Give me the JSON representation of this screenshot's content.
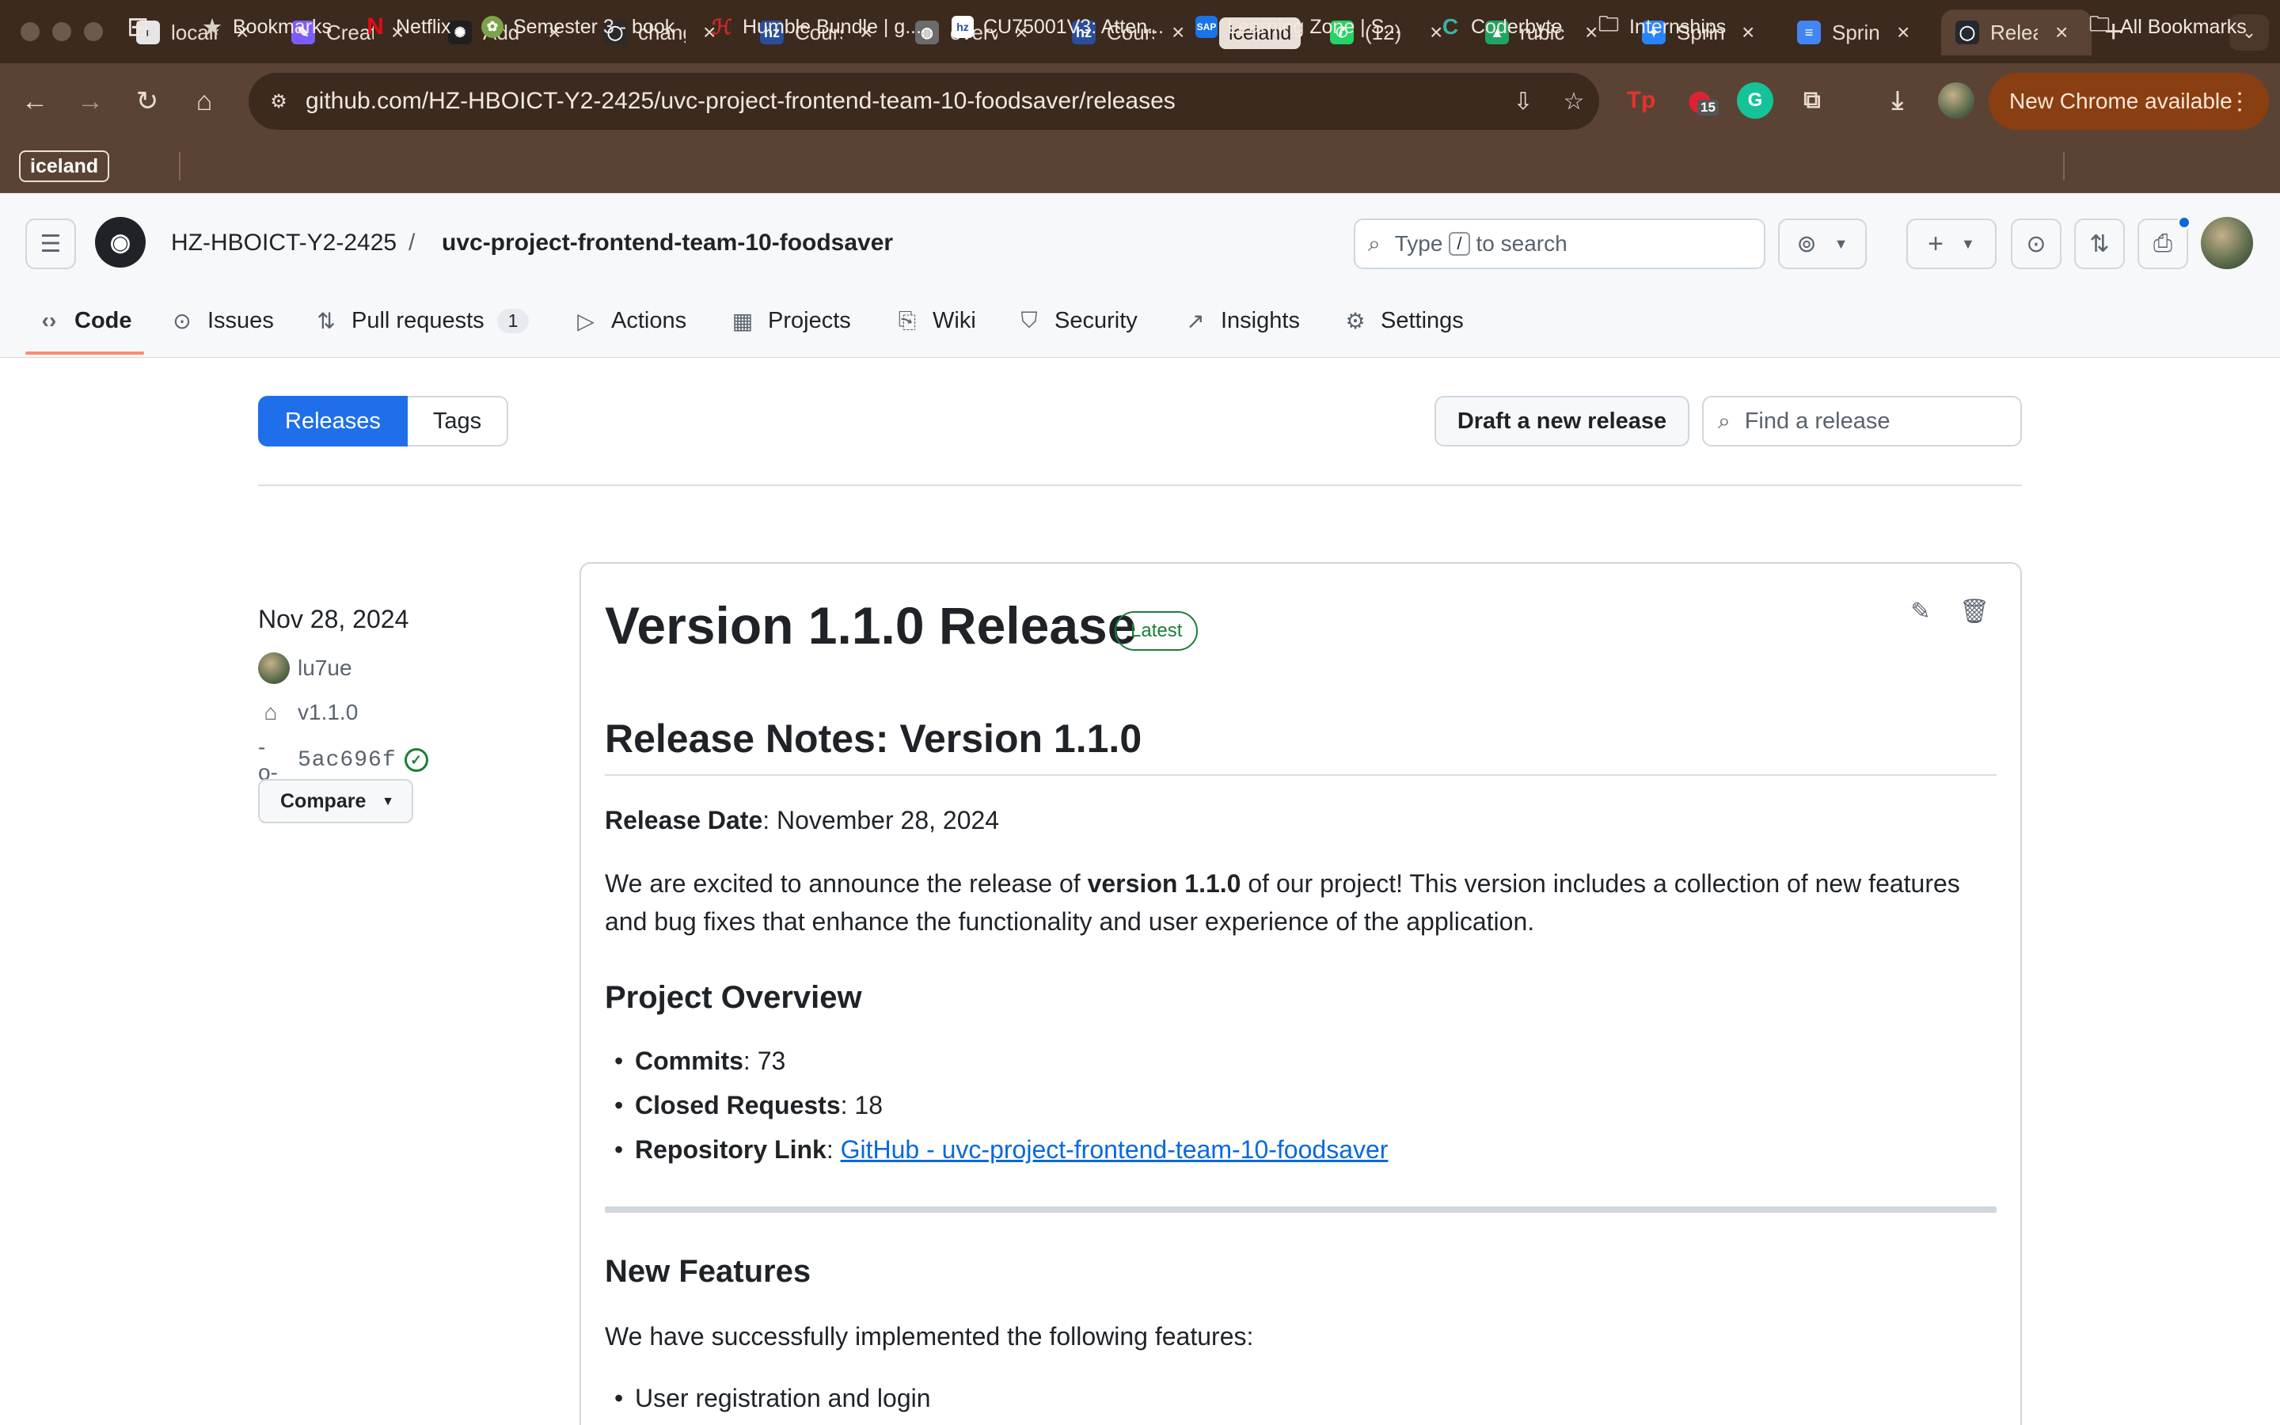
{
  "browser": {
    "tabs": [
      {
        "title": "localhost",
        "favicon_color": "#e6e6e6",
        "favicon_char": "◐"
      },
      {
        "title": "Create",
        "favicon_color": "#7b5cff",
        "favicon_char": "✎"
      },
      {
        "title": "Add",
        "favicon_color": "#1f1f1f",
        "favicon_char": "✺"
      },
      {
        "title": "changes",
        "favicon_color": "#2b2b2b",
        "favicon_char": "◯"
      },
      {
        "title": "Course",
        "favicon_color": "#2a4e9b",
        "favicon_char": "hz"
      },
      {
        "title": "overview",
        "favicon_color": "#6b6b6b",
        "favicon_char": "◍"
      },
      {
        "title": "Course",
        "favicon_color": "#2a4e9b",
        "favicon_char": "hz"
      },
      {
        "title": "(12)",
        "favicon_color": "#25d366",
        "favicon_char": "✆"
      },
      {
        "title": "rubic",
        "favicon_color": "#1fa463",
        "favicon_char": "▲"
      },
      {
        "title": "Sprint",
        "favicon_color": "#2684ff",
        "favicon_char": "✦"
      },
      {
        "title": "Sprint",
        "favicon_color": "#4285f4",
        "favicon_char": "≡"
      },
      {
        "title": "Releases",
        "favicon_color": "#24292f",
        "favicon_char": "◯"
      }
    ],
    "tab_group_label": "iceland",
    "url": "github.com/HZ-HBOICT-Y2-2425/uvc-project-frontend-team-10-foodsaver/releases",
    "extension_badge": "15",
    "update_label": "New Chrome available",
    "bookmarks_group": "iceland",
    "bookmarks": [
      {
        "label": "Bookmarks",
        "icon": "star-icon",
        "color": "#d9cfc6"
      },
      {
        "label": "Netflix",
        "icon": "netflix-icon",
        "color": "#e50914"
      },
      {
        "label": "Semester 3 - book",
        "icon": "book-icon",
        "color": "#7aa34a"
      },
      {
        "label": "Humble Bundle | g...",
        "icon": "humble-icon",
        "color": "#cc2929"
      },
      {
        "label": "CU75001V3: Atten...",
        "icon": "hz-icon",
        "color": "#2a4e9b"
      },
      {
        "label": "Learning Zone | S...",
        "icon": "sap-icon",
        "color": "#1a73e8"
      },
      {
        "label": "Coderbyte",
        "icon": "coderbyte-icon",
        "color": "#3bb2a1"
      },
      {
        "label": "Internships",
        "icon": "folder-icon",
        "color": "#d9cfc6"
      }
    ],
    "all_bookmarks": "All Bookmarks"
  },
  "github": {
    "owner": "HZ-HBOICT-Y2-2425",
    "repo": "uvc-project-frontend-team-10-foodsaver",
    "search_prefix": "Type",
    "search_key": "/",
    "search_suffix": "to search",
    "tabs": [
      {
        "label": "Code",
        "icon": "code-icon"
      },
      {
        "label": "Issues",
        "icon": "issues-icon"
      },
      {
        "label": "Pull requests",
        "icon": "pull-request-icon",
        "count": "1"
      },
      {
        "label": "Actions",
        "icon": "actions-icon"
      },
      {
        "label": "Projects",
        "icon": "projects-icon"
      },
      {
        "label": "Wiki",
        "icon": "wiki-icon"
      },
      {
        "label": "Security",
        "icon": "shield-icon"
      },
      {
        "label": "Insights",
        "icon": "graph-icon"
      },
      {
        "label": "Settings",
        "icon": "gear-icon"
      }
    ]
  },
  "releases_page": {
    "subnav": {
      "releases": "Releases",
      "tags": "Tags"
    },
    "draft_button": "Draft a new release",
    "find_placeholder": "Find a release"
  },
  "release": {
    "date": "Nov 28, 2024",
    "author": "lu7ue",
    "tag": "v1.1.0",
    "commit": "5ac696f",
    "compare_label": "Compare",
    "title": "Version 1.1.0 Release",
    "badge": "Latest",
    "notes": {
      "heading": "Release Notes: Version 1.1.0",
      "release_date_label": "Release Date",
      "release_date_value": ": November 28, 2024",
      "intro_before": "We are excited to announce the release of ",
      "intro_bold": "version 1.1.0",
      "intro_after": " of our project! This version includes a collection of new features and bug fixes that enhance the functionality and user experience of the application.",
      "overview_heading": "Project Overview",
      "overview": [
        {
          "label": "Commits",
          "value": ": 73"
        },
        {
          "label": "Closed Requests",
          "value": ": 18"
        },
        {
          "label": "Repository Link",
          "value": ": ",
          "link": "GitHub - uvc-project-frontend-team-10-foodsaver"
        }
      ],
      "features_heading": "New Features",
      "features_intro": "We have successfully implemented the following features:",
      "features": [
        "User registration and login"
      ]
    }
  }
}
